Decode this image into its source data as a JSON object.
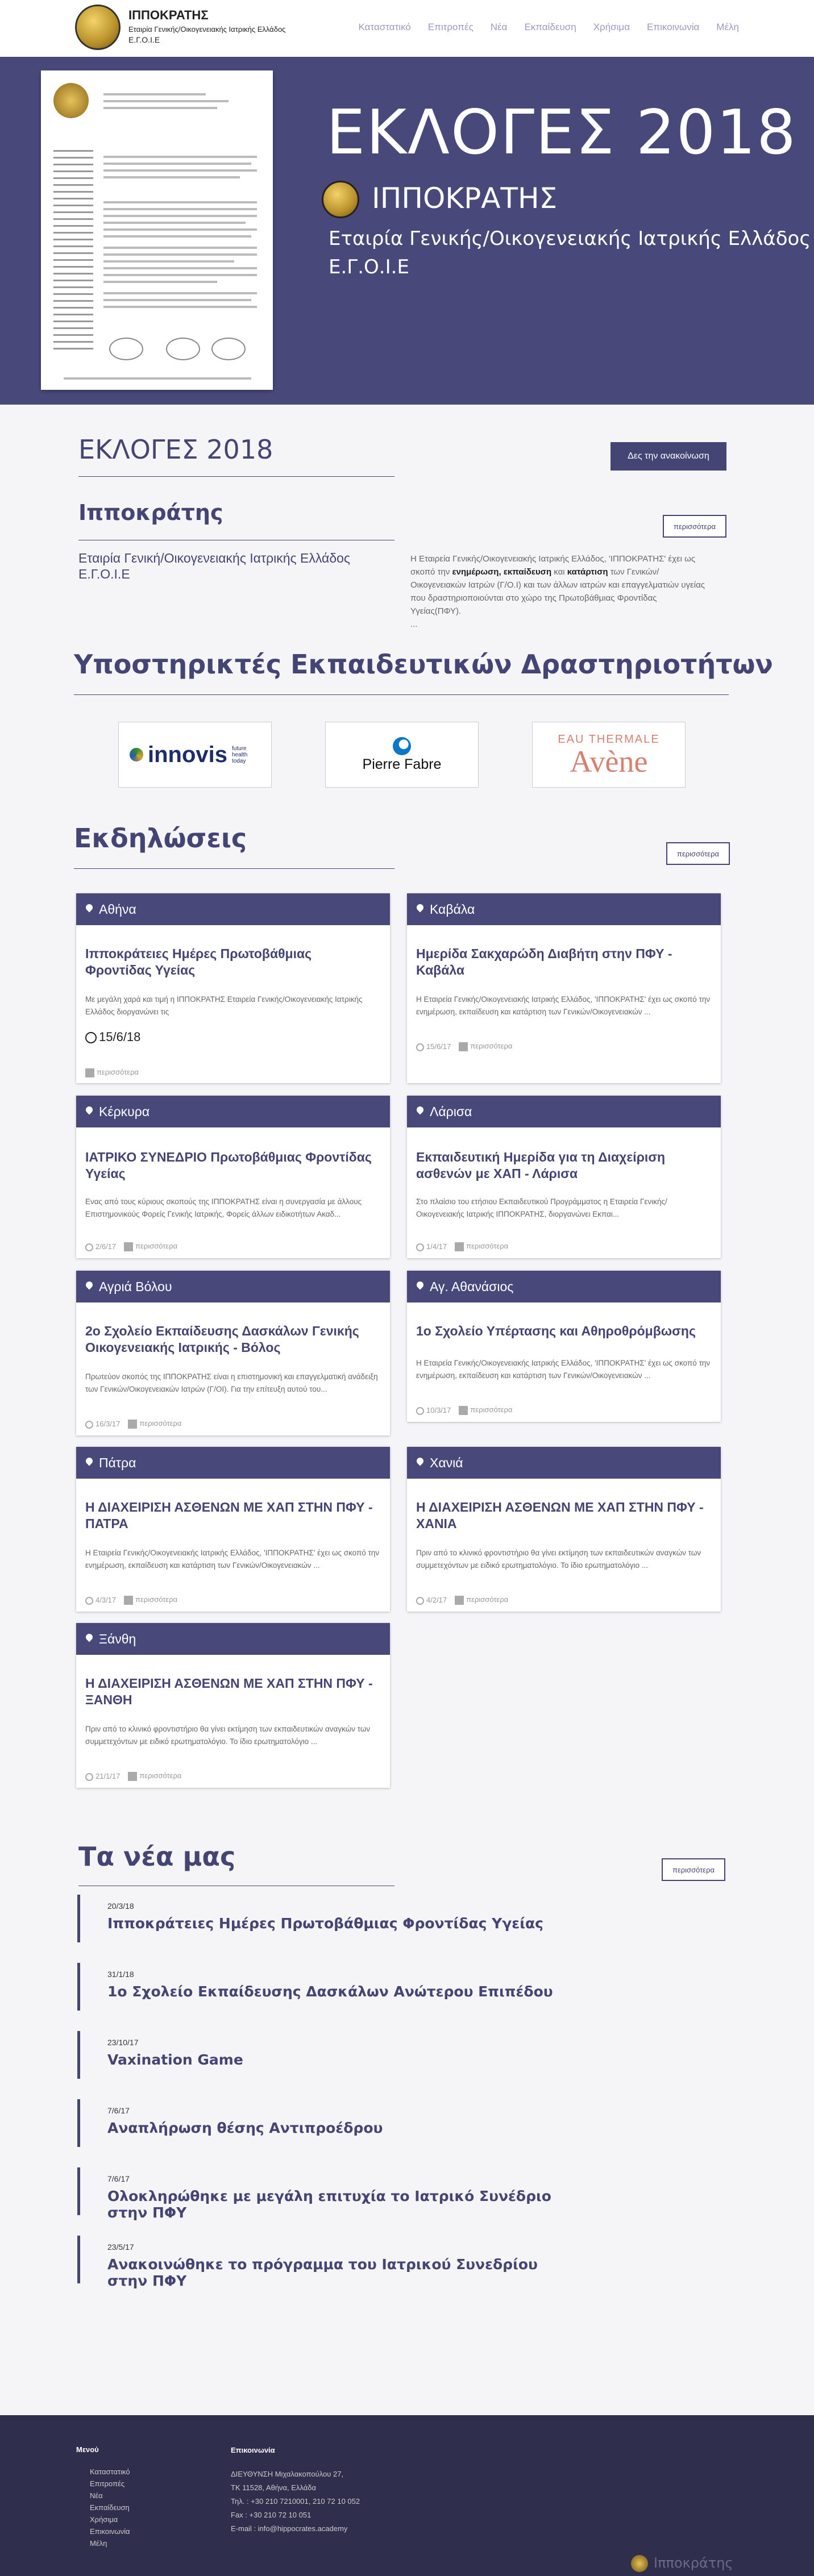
{
  "header": {
    "brand_name": "ΙΠΠΟΚΡΑΤΗΣ",
    "brand_line2": "Εταιρία Γενικής/Οικογενειακής Ιατρικής Ελλάδος",
    "brand_line3": "Ε.Γ.Ο.Ι.Ε",
    "nav": [
      "Καταστατικό",
      "Επιτροπές",
      "Νέα",
      "Εκπαίδευση",
      "Χρήσιμα",
      "Επικοινωνία",
      "Μέλη"
    ]
  },
  "hero": {
    "title": "ΕΚΛΟΓΕΣ 2018",
    "subtitle": "ΙΠΠΟΚΡΑΤΗΣ",
    "line1": "Εταιρία Γενικής/Οικογενειακής Ιατρικής Ελλάδος",
    "line2": "Ε.Γ.Ο.Ι.Ε"
  },
  "elections": {
    "title": "ΕΚΛΟΓΕΣ 2018",
    "button": "Δες την ανακοίνωση"
  },
  "about": {
    "title": "Ιπποκράτης",
    "button": "περισσότερα",
    "left_text": "Εταιρία Γενική/Οικογενειακής Ιατρικής Ελλάδος Ε.Γ.Ο.Ι.Ε",
    "right_text_1": "Η Εταιρεία Γενικής/Οικογενειακής Ιατρικής Ελλάδος, 'ΙΠΠΟΚΡΑΤΗΣ' έχει ως σκοπό την",
    "right_bold_1": "ενημέρωση, εκπαίδευση",
    "right_text_2": "και",
    "right_bold_2": "κατάρτιση",
    "right_text_3": "των Γενικών/Οικογενειακών Ιατρών (Γ/Ο.Ι) και των άλλων ιατρών και επαγγελματιών υγείας που δραστηριοποιούνται στο χώρο της Πρωτοβάθμιας Φροντίδας Υγείας(ΠΦΥ).",
    "ellipsis": "..."
  },
  "sponsors": {
    "title": "Υποστηρικτές Εκπαιδευτικών Δραστηριοτήτων",
    "items": [
      "innovis",
      "future health today",
      "Pierre Fabre",
      "EAU THERMALE",
      "Avène"
    ]
  },
  "events": {
    "title": "Εκδηλώσεις",
    "button": "περισσότερα",
    "more_label": "περισσότερα",
    "cards": [
      {
        "city": "Αθήνα",
        "title": "Ιπποκράτειες Ημέρες Πρωτοβάθμιας Φροντίδας Υγείας",
        "text": "Με μεγάλη χαρά και τιμή η ΙΠΠΟΚΡΑΤΗΣ Εταιρεία Γενικής/Οικογενειακής Ιατρικής Ελλάδος διοργανώνει τις",
        "date": "15/6/18"
      },
      {
        "city": "Καβάλα",
        "title": "Ημερίδα Σακχαρώδη Διαβήτη στην ΠΦΥ - Καβάλα",
        "text": "Η Εταιρεία Γενικής/Οικογενειακής Ιατρικής Ελλάδος, 'ΙΠΠΟΚΡΑΤΗΣ' έχει ως σκοπό την ενημέρωση, εκπαίδευση και κατάρτιση των Γενικών/Οικογενειακών ...",
        "date": "15/6/17"
      },
      {
        "city": "Κέρκυρα",
        "title": "ΙΑΤΡΙΚΟ ΣΥΝΕΔΡΙΟ Πρωτοβάθμιας Φροντίδας Υγείας",
        "text": "Ενας από τους κύριους σκοπούς της ΙΠΠΟΚΡΑΤΗΣ είναι η συνεργασία με άλλους Επιστημονικούς Φορείς Γενικής Ιατρικής, Φορείς άλλων ειδικοτήτων Ακαδ...",
        "date": "2/6/17"
      },
      {
        "city": "Λάρισα",
        "title": "Εκπαιδευτική Ημερίδα για τη Διαχείριση ασθενών με ΧΑΠ - Λάρισα",
        "text": "Στο πλαίσιο του ετήσιου Εκπαιδευτικού Προγράμματος η Εταιρεία Γενικής/Οικογενειακής Ιατρικής ΙΠΠΟΚΡΑΤΗΣ, διοργανώνει Εκπαι...",
        "date": "1/4/17"
      },
      {
        "city": "Αγριά Βόλου",
        "title": "2ο Σχολείο Εκπαίδευσης Δασκάλων Γενικής Οικογενειακής Ιατρικής - Βόλος",
        "text": "Πρωτεύον σκοπός της ΙΠΠΟΚΡΑΤΗΣ είναι η επιστημονική και επαγγελματική ανάδειξη των Γενικών/Οικογενειακών Ιατρών (Γ/ΟΙ). Για την επίτευξη αυτού του...",
        "date": "16/3/17"
      },
      {
        "city": "Αγ. Αθανάσιος",
        "title": "1ο Σχολείο Υπέρτασης και Αθηροθρόμβωσης",
        "text": "Η Εταιρεία Γενικής/Οικογενειακής Ιατρικής Ελλάδος, 'ΙΠΠΟΚΡΑΤΗΣ' έχει ως σκοπό την ενημέρωση, εκπαίδευση και κατάρτιση των Γενικών/Οικογενειακών ...",
        "date": "10/3/17"
      },
      {
        "city": "Πάτρα",
        "title": "Η ΔΙΑΧΕΙΡΙΣΗ ΑΣΘΕΝΩΝ ΜΕ ΧΑΠ ΣΤΗΝ ΠΦΥ - ΠΑΤΡΑ",
        "text": "Η Εταιρεία Γενικής/Οικογενειακής Ιατρικής Ελλάδος, 'ΙΠΠΟΚΡΑΤΗΣ' έχει ως σκοπό την ενημέρωση, εκπαίδευση και κατάρτιση των Γενικών/Οικογενειακών ...",
        "date": "4/3/17"
      },
      {
        "city": "Χανιά",
        "title": "Η ΔΙΑΧΕΙΡΙΣΗ ΑΣΘΕΝΩΝ ΜΕ ΧΑΠ ΣΤΗΝ ΠΦΥ - ΧΑΝΙΑ",
        "text": "Πριν από το κλινικό φροντιστήριο θα γίνει εκτίμηση των εκπαιδευτικών αναγκών των συμμετεχόντων με ειδικό ερωτηματολόγιο. Το ίδιο ερωτηματολόγιο ...",
        "date": "4/2/17"
      },
      {
        "city": "Ξάνθη",
        "title": "Η ΔΙΑΧΕΙΡΙΣΗ ΑΣΘΕΝΩΝ ΜΕ ΧΑΠ ΣΤΗΝ ΠΦΥ - ΞΑΝΘΗ",
        "text": "Πριν από το κλινικό φροντιστήριο θα γίνει εκτίμηση των εκπαιδευτικών αναγκών των συμμετεχόντων με ειδικό ερωτηματολόγιο. Το ίδιο ερωτηματολόγιο ...",
        "date": "21/1/17"
      }
    ]
  },
  "news": {
    "title": "Τα νέα μας",
    "button": "περισσότερα",
    "items": [
      {
        "date": "20/3/18",
        "title": "Ιπποκράτειες Ημέρες Πρωτοβάθμιας Φροντίδας Υγείας"
      },
      {
        "date": "31/1/18",
        "title": "1ο Σχολείο Εκπαίδευσης Δασκάλων Ανώτερου Επιπέδου"
      },
      {
        "date": "23/10/17",
        "title": "Vaxination Game"
      },
      {
        "date": "7/6/17",
        "title": "Αναπλήρωση θέσης Αντιπροέδρου"
      },
      {
        "date": "7/6/17",
        "title": "Ολοκληρώθηκε με μεγάλη επιτυχία το Ιατρικό Συνέδριο στην ΠΦΥ"
      },
      {
        "date": "23/5/17",
        "title": "Ανακοινώθηκε το πρόγραμμα του Ιατρικού Συνεδρίου στην ΠΦΥ"
      }
    ]
  },
  "footer": {
    "menu_title": "Μενού",
    "menu": [
      "Καταστατικό",
      "Επιτροπές",
      "Νέα",
      "Εκπαίδευση",
      "Χρήσιμα",
      "Επικοινωνία",
      "Μέλη"
    ],
    "contact_title": "Επικοινωνία",
    "contact": [
      "ΔΙΕΥΘΥΝΣΗ Μιχαλακοπούλου 27,",
      "ΤΚ 11528, Αθήνα, Ελλάδα",
      "Τηλ. : +30 210 7210001, 210 72 10 052",
      "Fax : +30 210 72 10 051",
      "E-mail : info@hippocrates.academy"
    ],
    "brand": "Ιπποκράτης"
  }
}
